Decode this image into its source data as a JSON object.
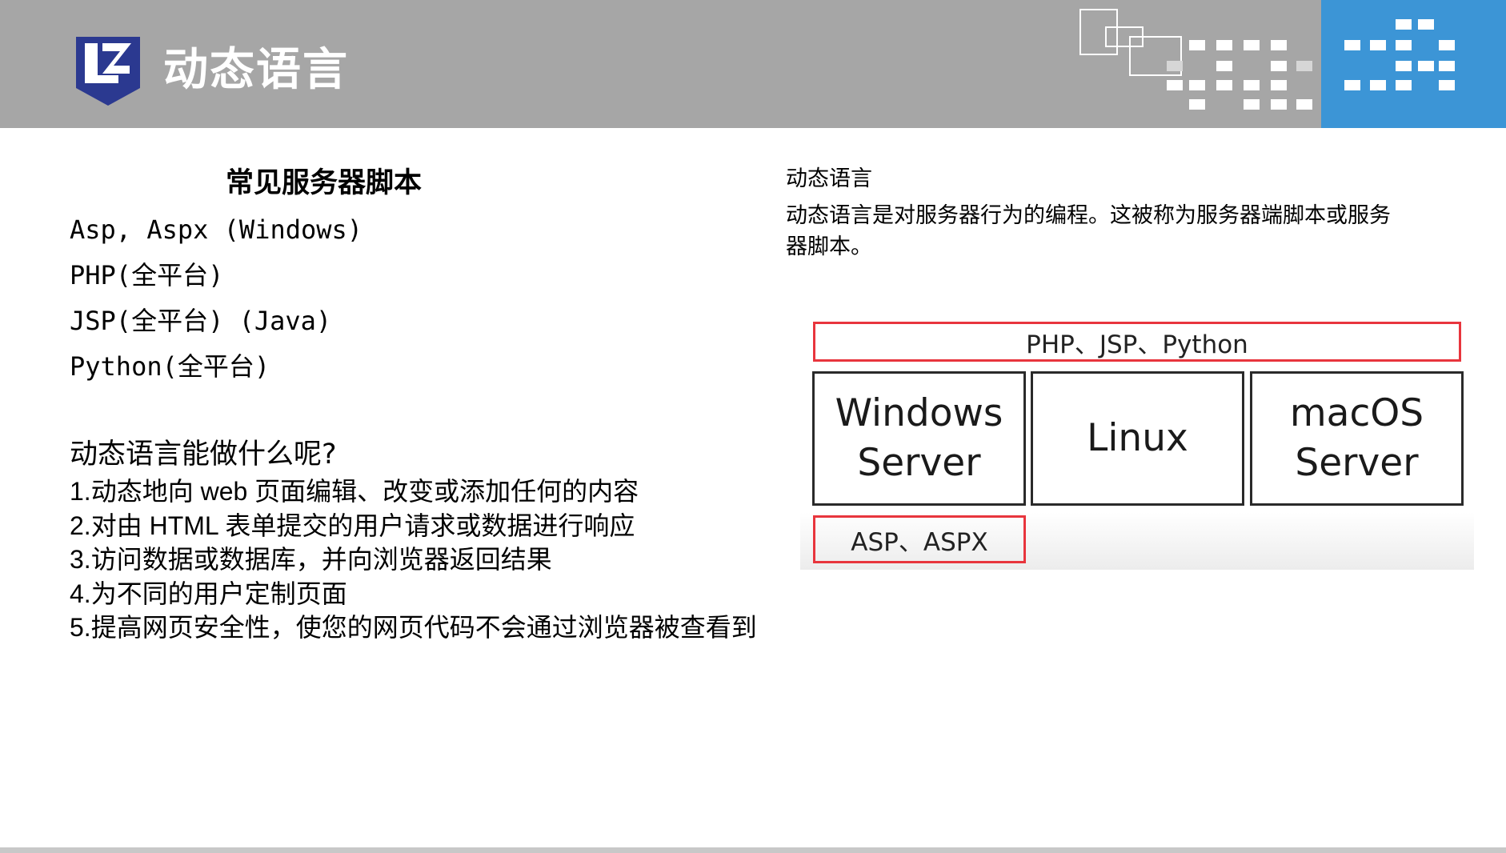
{
  "header": {
    "title": "动态语言",
    "logo": "zj-shield-logo",
    "colors": {
      "bar": "#a6a6a6",
      "panel": "#3c95d6",
      "logo": "#2b3990"
    }
  },
  "left": {
    "heading": "常见服务器脚本",
    "scripts": [
      "Asp, Aspx (Windows)",
      "PHP(全平台)",
      "JSP(全平台) (Java)",
      "Python(全平台)"
    ],
    "question": "动态语言能做什么呢?",
    "points": [
      "1.动态地向 web 页面编辑、改变或添加任何的内容",
      "2.对由 HTML 表单提交的用户请求或数据进行响应",
      "3.访问数据或数据库，并向浏览器返回结果",
      "4.为不同的用户定制页面",
      "5.提高网页安全性，使您的网页代码不会通过浏览器被查看到"
    ]
  },
  "right": {
    "title": "动态语言",
    "description": "动态语言是对服务器行为的编程。这被称为服务器端脚本或服务器脚本。"
  },
  "diagram": {
    "top_bar": "PHP、JSP、Python",
    "servers": [
      {
        "line1": "Windows",
        "line2": "Server"
      },
      {
        "line1": "Linux",
        "line2": ""
      },
      {
        "line1": "macOS",
        "line2": "Server"
      }
    ],
    "bottom_bar": "ASP、ASPX",
    "colors": {
      "highlight_border": "#e8353d",
      "box_border": "#2a2a2a"
    }
  }
}
